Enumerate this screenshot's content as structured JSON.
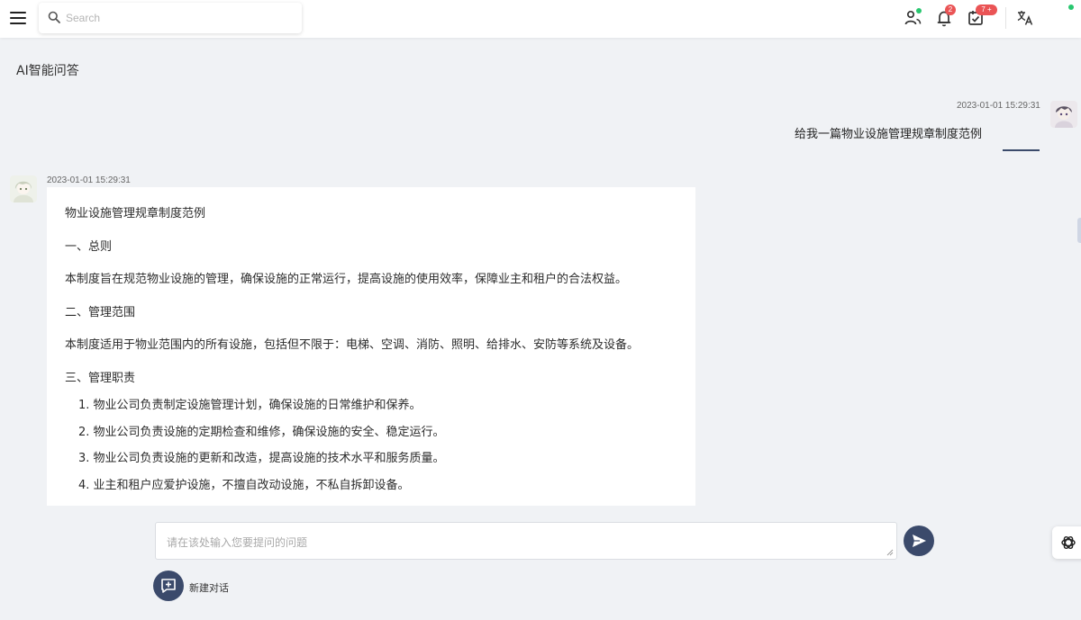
{
  "topbar": {
    "search_placeholder": "Search",
    "notifications_count": "2",
    "tasks_count": "7 +"
  },
  "page": {
    "title": "AI智能问答"
  },
  "user_message": {
    "timestamp": "2023-01-01 15:29:31",
    "text": "给我一篇物业设施管理规章制度范例"
  },
  "bot_message": {
    "timestamp": "2023-01-01 15:29:31",
    "paragraphs": [
      "物业设施管理规章制度范例",
      "一、总则",
      "本制度旨在规范物业设施的管理，确保设施的正常运行，提高设施的使用效率，保障业主和租户的合法权益。",
      "二、管理范围",
      "本制度适用于物业范围内的所有设施，包括但不限于：电梯、空调、消防、照明、给排水、安防等系统及设备。",
      "三、管理职责"
    ],
    "list_items": [
      "1. 物业公司负责制定设施管理计划，确保设施的日常维护和保养。",
      "2. 物业公司负责设施的定期检查和维修，确保设施的安全、稳定运行。",
      "3. 物业公司负责设施的更新和改造，提高设施的技术水平和服务质量。",
      "4. 业主和租户应爱护设施，不擅自改动设施，不私自拆卸设备。"
    ]
  },
  "composer": {
    "placeholder": "请在该处输入您要提问的问题",
    "new_chat_label": "新建对话"
  },
  "colors": {
    "accent": "#3b4a6b",
    "badge": "#ea5455",
    "online": "#28c76f",
    "background": "#f0f2f5"
  }
}
